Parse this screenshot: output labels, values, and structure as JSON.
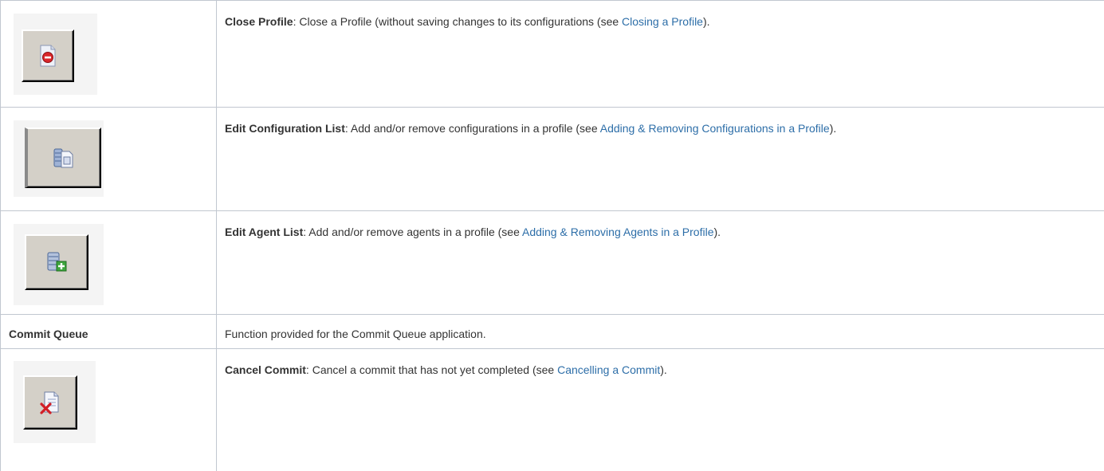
{
  "rows": [
    {
      "icon": "close-profile-icon",
      "term": "Close Profile",
      "sep": ": ",
      "text_before": "Close a Profile (without saving changes to its configurations (see ",
      "link": "Closing a Profile",
      "text_after": ")."
    },
    {
      "icon": "edit-configuration-list-icon",
      "term": "Edit Configuration List",
      "sep": ": ",
      "text_before": "Add and/or remove configurations in a profile (see ",
      "link": "Adding & Removing Configurations in a Profile",
      "text_after": ")."
    },
    {
      "icon": "edit-agent-list-icon",
      "term": "Edit Agent List",
      "sep": ": ",
      "text_before": "Add and/or remove agents in a profile (see ",
      "link": "Adding & Removing Agents in a Profile",
      "text_after": ")."
    },
    {
      "icon": "cancel-commit-icon",
      "term": "Cancel Commit",
      "sep": ": ",
      "text_before": "Cancel a commit that has not yet completed (see ",
      "link": "Cancelling a Commit",
      "text_after": ")."
    }
  ],
  "section": {
    "label": "Commit Queue",
    "description": "Function provided for the Commit Queue application."
  },
  "colors": {
    "link": "#2d6ea8",
    "border": "#c1c7d0",
    "text": "#333333",
    "button_face": "#d4d0c8"
  }
}
